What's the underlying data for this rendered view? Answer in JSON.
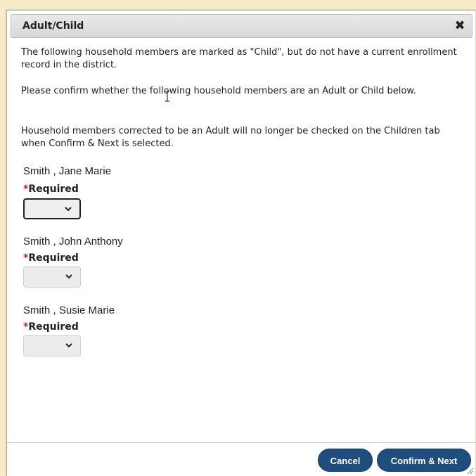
{
  "dialog": {
    "title": "Adult/Child",
    "close_symbol": "✖",
    "paragraphs": [
      "The following household members are marked as \"Child\", but do not have a current enrollment record in the district.",
      "Please confirm whether the following household members are an Adult or Child below.",
      "Household members corrected to be an Adult will no longer be checked on the Children tab when Confirm & Next is selected."
    ],
    "members": [
      {
        "name": "Smith , Jane Marie",
        "required_star": "*",
        "required_label": "Required",
        "selected_value": ""
      },
      {
        "name": "Smith , John Anthony",
        "required_star": "*",
        "required_label": "Required",
        "selected_value": ""
      },
      {
        "name": "Smith , Susie Marie",
        "required_star": "*",
        "required_label": "Required",
        "selected_value": ""
      }
    ],
    "buttons": {
      "cancel": "Cancel",
      "confirm_next": "Confirm & Next"
    }
  },
  "colors": {
    "background": "#f7ecc8",
    "button": "#1f4d7e",
    "required_star": "#c0262d"
  },
  "icons": {
    "close": "close-icon",
    "select_arrow": "chevron-down-icon",
    "resize": "resize-grip-icon",
    "cursor": "text-cursor-icon"
  }
}
